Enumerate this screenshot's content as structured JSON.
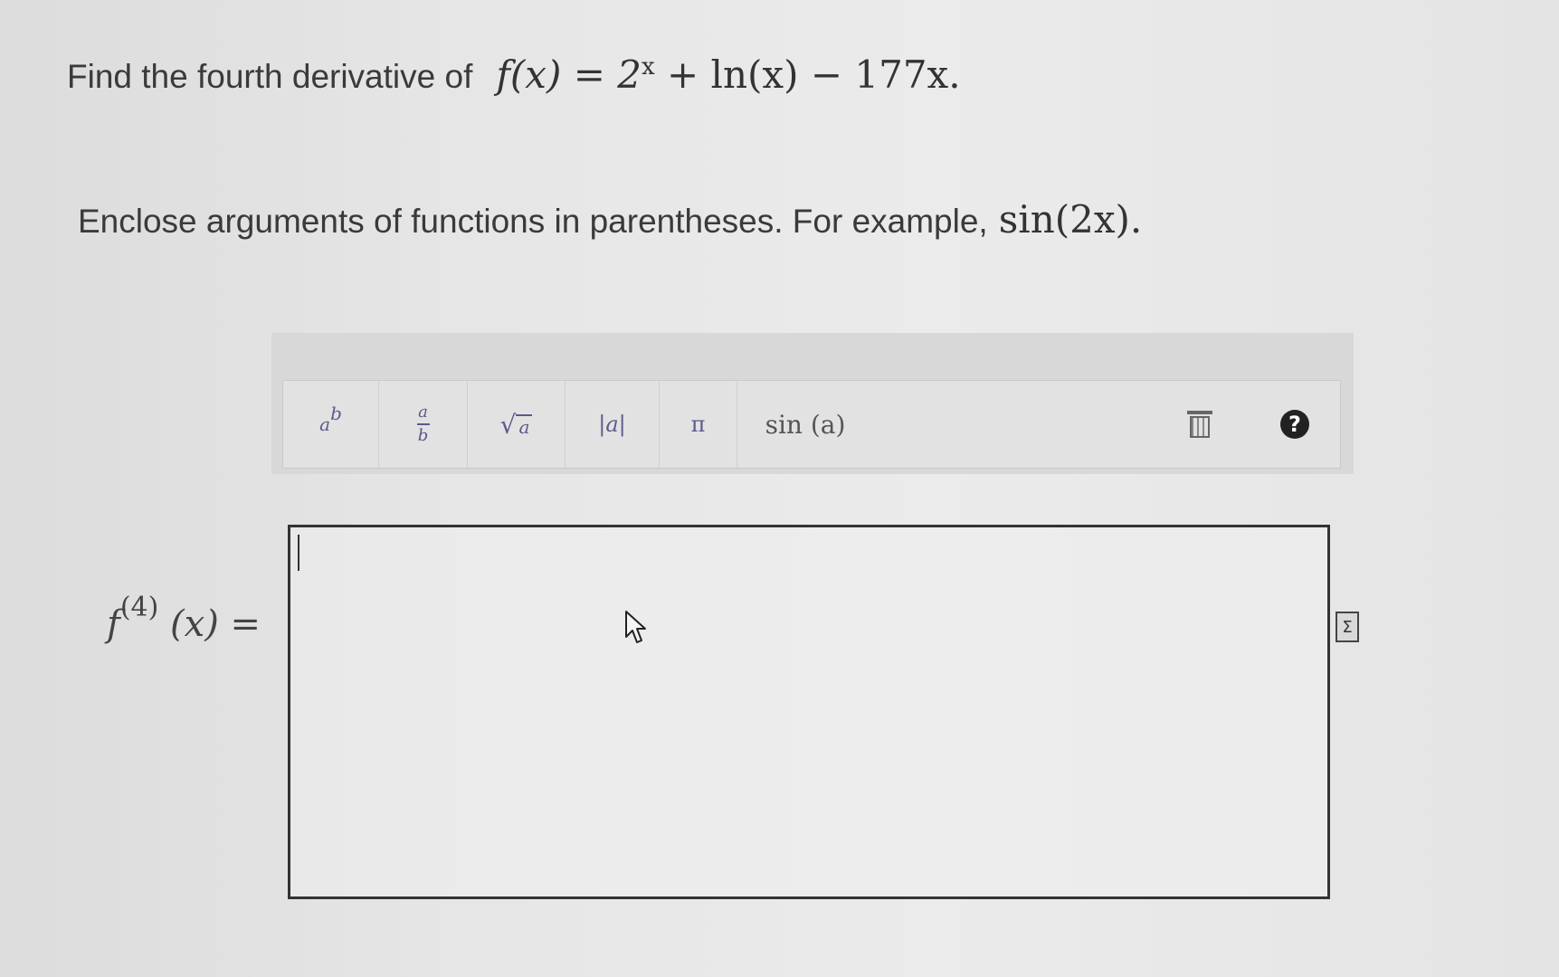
{
  "question": {
    "text": "Find the fourth derivative of",
    "formula_lhs": "f(x) = 2",
    "formula_exp": "x",
    "formula_rhs": " + ln(x) − 177x."
  },
  "instruction": {
    "text": "Enclose arguments of functions in parentheses. For example,",
    "example": "sin(2x)."
  },
  "toolbar": {
    "power": {
      "base": "a",
      "exp": "b"
    },
    "fraction": {
      "num": "a",
      "den": "b"
    },
    "sqrt": {
      "symbol": "√",
      "radicand": "a"
    },
    "abs": "|a|",
    "pi": "π",
    "sin": "sin (a)",
    "trash_icon": "trash-icon",
    "help": "?"
  },
  "answer": {
    "label_f": "f",
    "label_order": "(4)",
    "label_arg": "(x) =",
    "value": ""
  },
  "sigma": "Σ"
}
